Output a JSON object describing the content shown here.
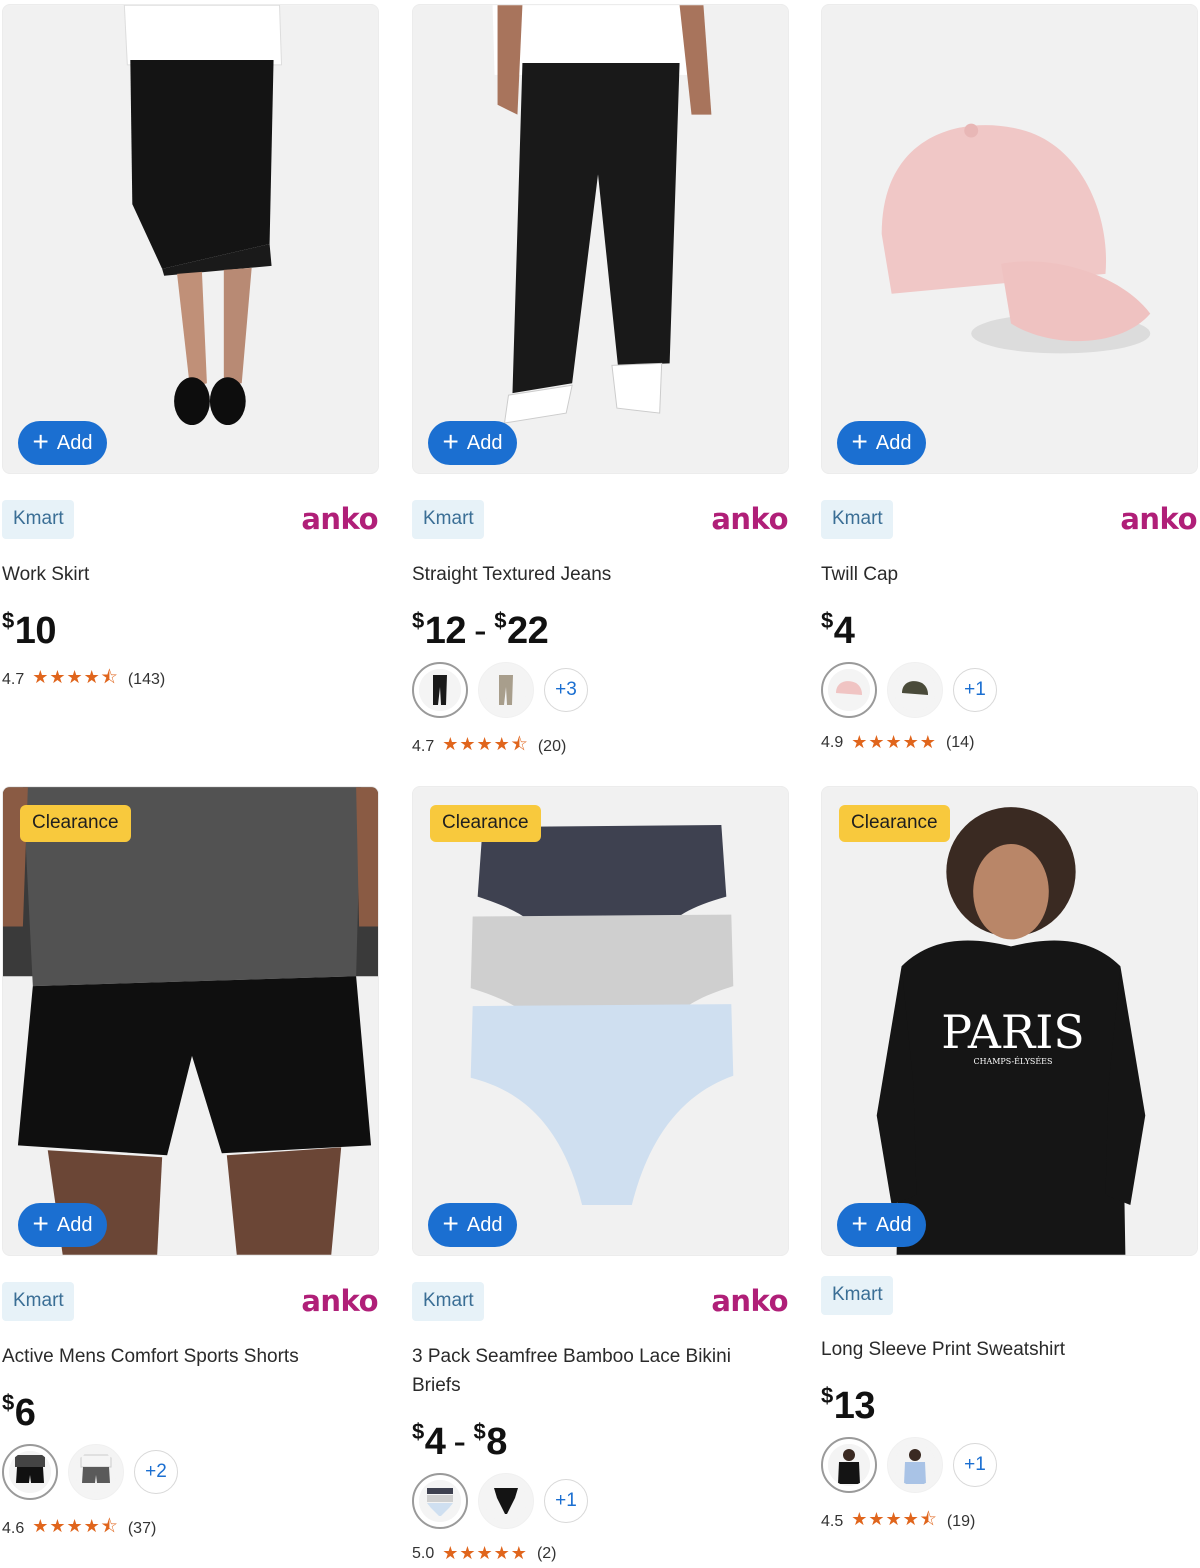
{
  "products": [
    {
      "brand_badge": "Kmart",
      "logo": "anko",
      "title": "Work Skirt",
      "price": {
        "from": "10",
        "to": null
      },
      "swatches": [],
      "rating": {
        "score": "4.7",
        "count": "(143)"
      },
      "add_label": "Add",
      "clearance": null
    },
    {
      "brand_badge": "Kmart",
      "logo": "anko",
      "title": "Straight Textured Jeans",
      "price": {
        "from": "12",
        "to": "22"
      },
      "swatches": [
        "black-jeans",
        "stone-jeans"
      ],
      "swatch_more": "+3",
      "rating": {
        "score": "4.7",
        "count": "(20)"
      },
      "add_label": "Add",
      "clearance": null
    },
    {
      "brand_badge": "Kmart",
      "logo": "anko",
      "title": "Twill Cap",
      "price": {
        "from": "4",
        "to": null
      },
      "swatches": [
        "pink-cap",
        "khaki-cap"
      ],
      "swatch_more": "+1",
      "rating": {
        "score": "4.9",
        "count": "(14)"
      },
      "add_label": "Add",
      "clearance": null
    },
    {
      "brand_badge": "Kmart",
      "logo": "anko",
      "title": "Active Mens Comfort Sports Shorts",
      "price": {
        "from": "6",
        "to": null
      },
      "swatches": [
        "black-shorts",
        "grey-shorts"
      ],
      "swatch_more": "+2",
      "rating": {
        "score": "4.6",
        "count": "(37)"
      },
      "add_label": "Add",
      "clearance": "Clearance"
    },
    {
      "brand_badge": "Kmart",
      "logo": "anko",
      "title": "3 Pack Seamfree Bamboo Lace Bikini Briefs",
      "price": {
        "from": "4",
        "to": "8"
      },
      "swatches": [
        "pastel-briefs",
        "black-briefs"
      ],
      "swatch_more": "+1",
      "rating": {
        "score": "5.0",
        "count": "(2)"
      },
      "add_label": "Add",
      "clearance": "Clearance"
    },
    {
      "brand_badge": "Kmart",
      "logo": null,
      "title": "Long Sleeve Print Sweatshirt",
      "price": {
        "from": "13",
        "to": null
      },
      "swatches": [
        "black-sweatshirt",
        "blue-sweatshirt"
      ],
      "swatch_more": "+1",
      "rating": {
        "score": "4.5",
        "count": "(19)"
      },
      "add_label": "Add",
      "clearance": "Clearance"
    }
  ],
  "sweatshirt_print": {
    "main": "PARIS",
    "sub": "CHAMPS-ÉLYSÉES"
  },
  "stars": {
    "full": "★★★★★",
    "four_half": "★★★★⯪"
  },
  "colors": {
    "add_button": "#1b6fd1",
    "clearance": "#f8c93d",
    "kmart_badge_bg": "#e7f2f8",
    "anko": "#b01f78",
    "stars": "#e0651c"
  },
  "icons": {
    "add": "plus-icon",
    "rating": "star-icon"
  }
}
